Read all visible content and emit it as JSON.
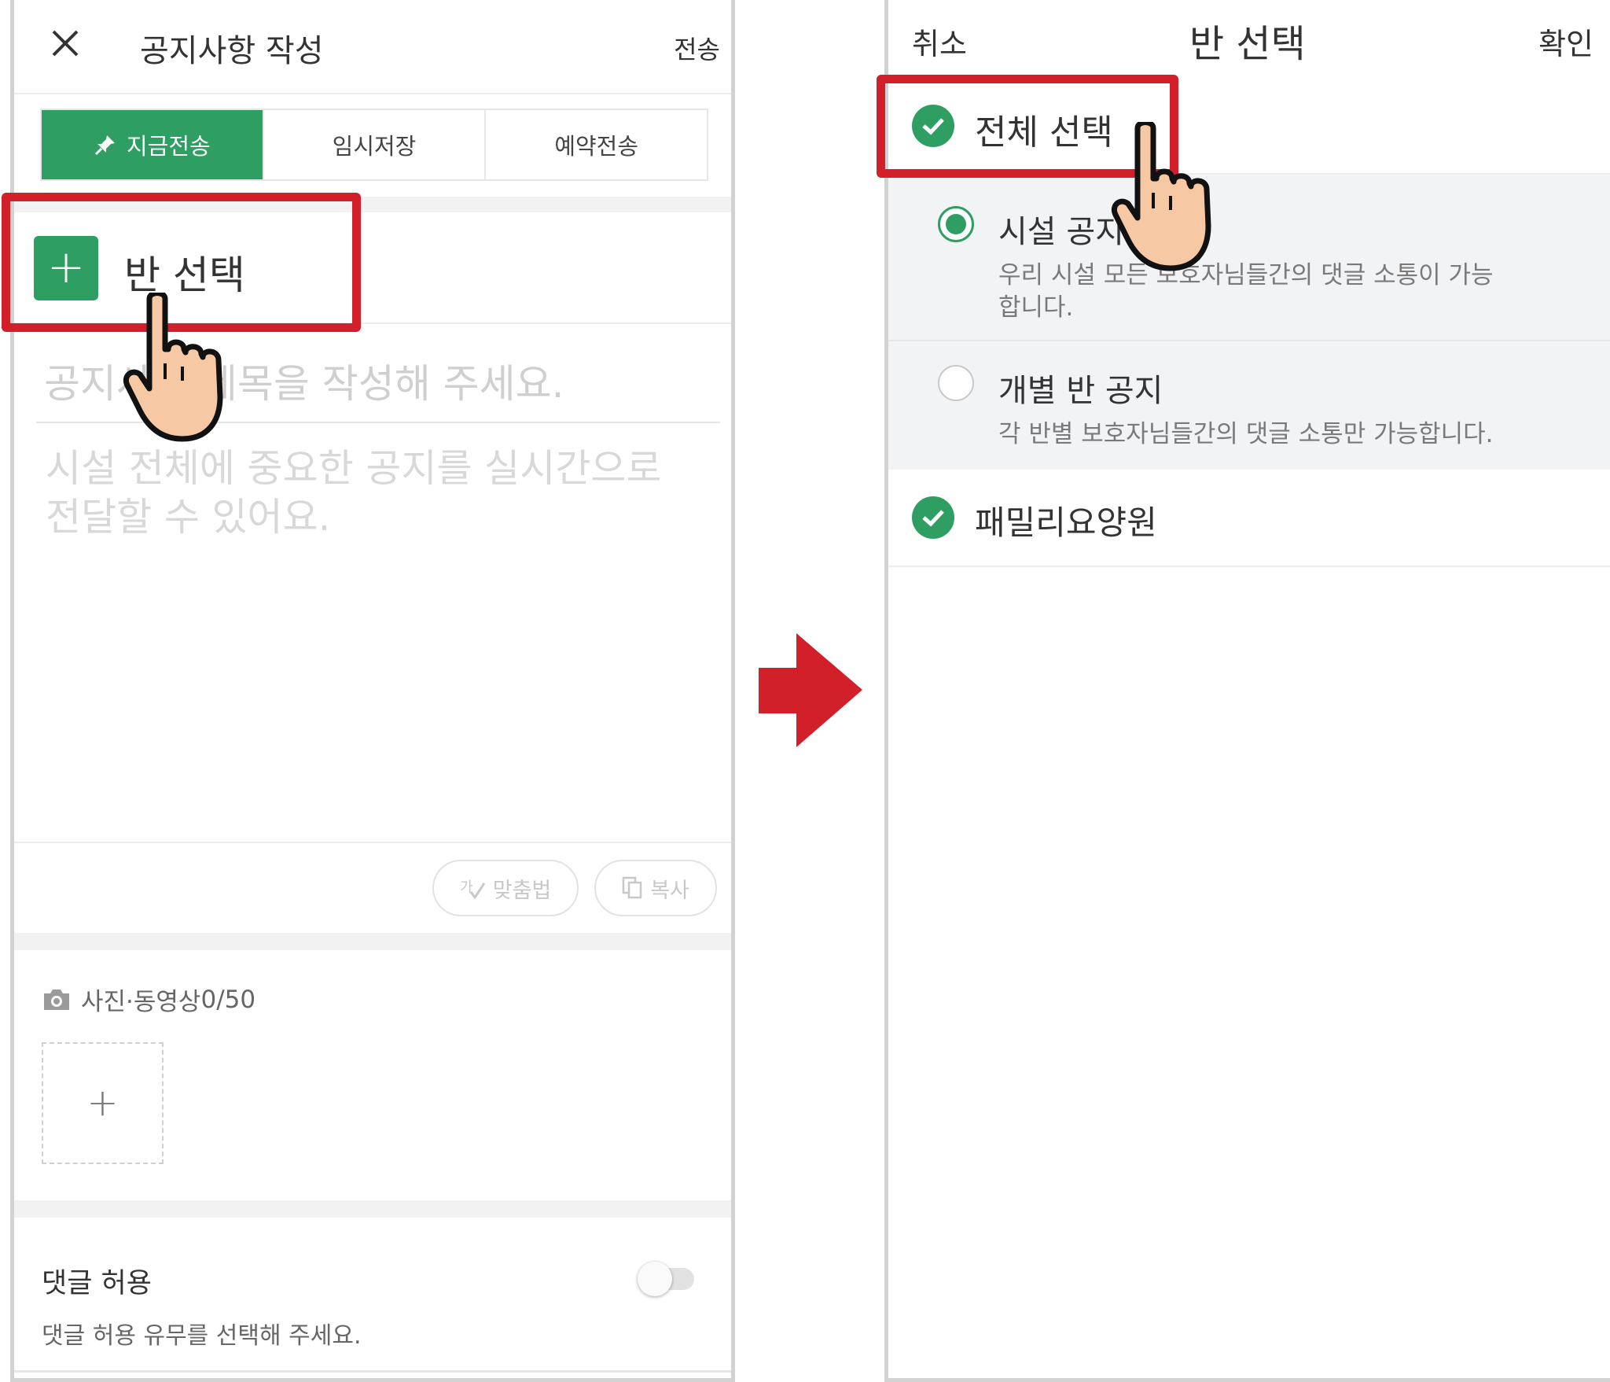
{
  "left_screen": {
    "header": {
      "close_icon": "close-icon",
      "title": "공지사항 작성",
      "send_label": "전송"
    },
    "modes": [
      {
        "label": "지금전송",
        "active": true,
        "icon": "pin-icon"
      },
      {
        "label": "임시저장",
        "active": false
      },
      {
        "label": "예약전송",
        "active": false
      }
    ],
    "class_select": {
      "plus": "+",
      "label": "반 선택"
    },
    "title_placeholder": "공지사항 제목을 작성해 주세요.",
    "body_placeholder_line1": "시설 전체에 중요한 공지를 실시간으로",
    "body_placeholder_line2": "전달할 수 있어요.",
    "spell_check_label": "맞춤법",
    "copy_label": "복사",
    "media": {
      "label": "사진·동영상",
      "count": "0/50",
      "add": "+"
    },
    "comments": {
      "title": "댓글 허용",
      "description": "댓글 허용 유무를 선택해 주세요.",
      "enabled": false
    }
  },
  "right_screen": {
    "header": {
      "cancel_label": "취소",
      "title": "반 선택",
      "confirm_label": "확인"
    },
    "select_all_label": "전체 선택",
    "options": [
      {
        "title": "시설 공지",
        "description": "우리 시설 모든 보호자님들간의 댓글 소통이 가능합니다.",
        "selected": true
      },
      {
        "title": "개별 반 공지",
        "description": "각 반별 보호자님들간의 댓글 소통만 가능합니다.",
        "selected": false
      }
    ],
    "facility_label": "패밀리요양원"
  },
  "colors": {
    "brand_green": "#2e9e63",
    "highlight_red": "#d2202a",
    "hand_skin": "#f6c8a4"
  }
}
